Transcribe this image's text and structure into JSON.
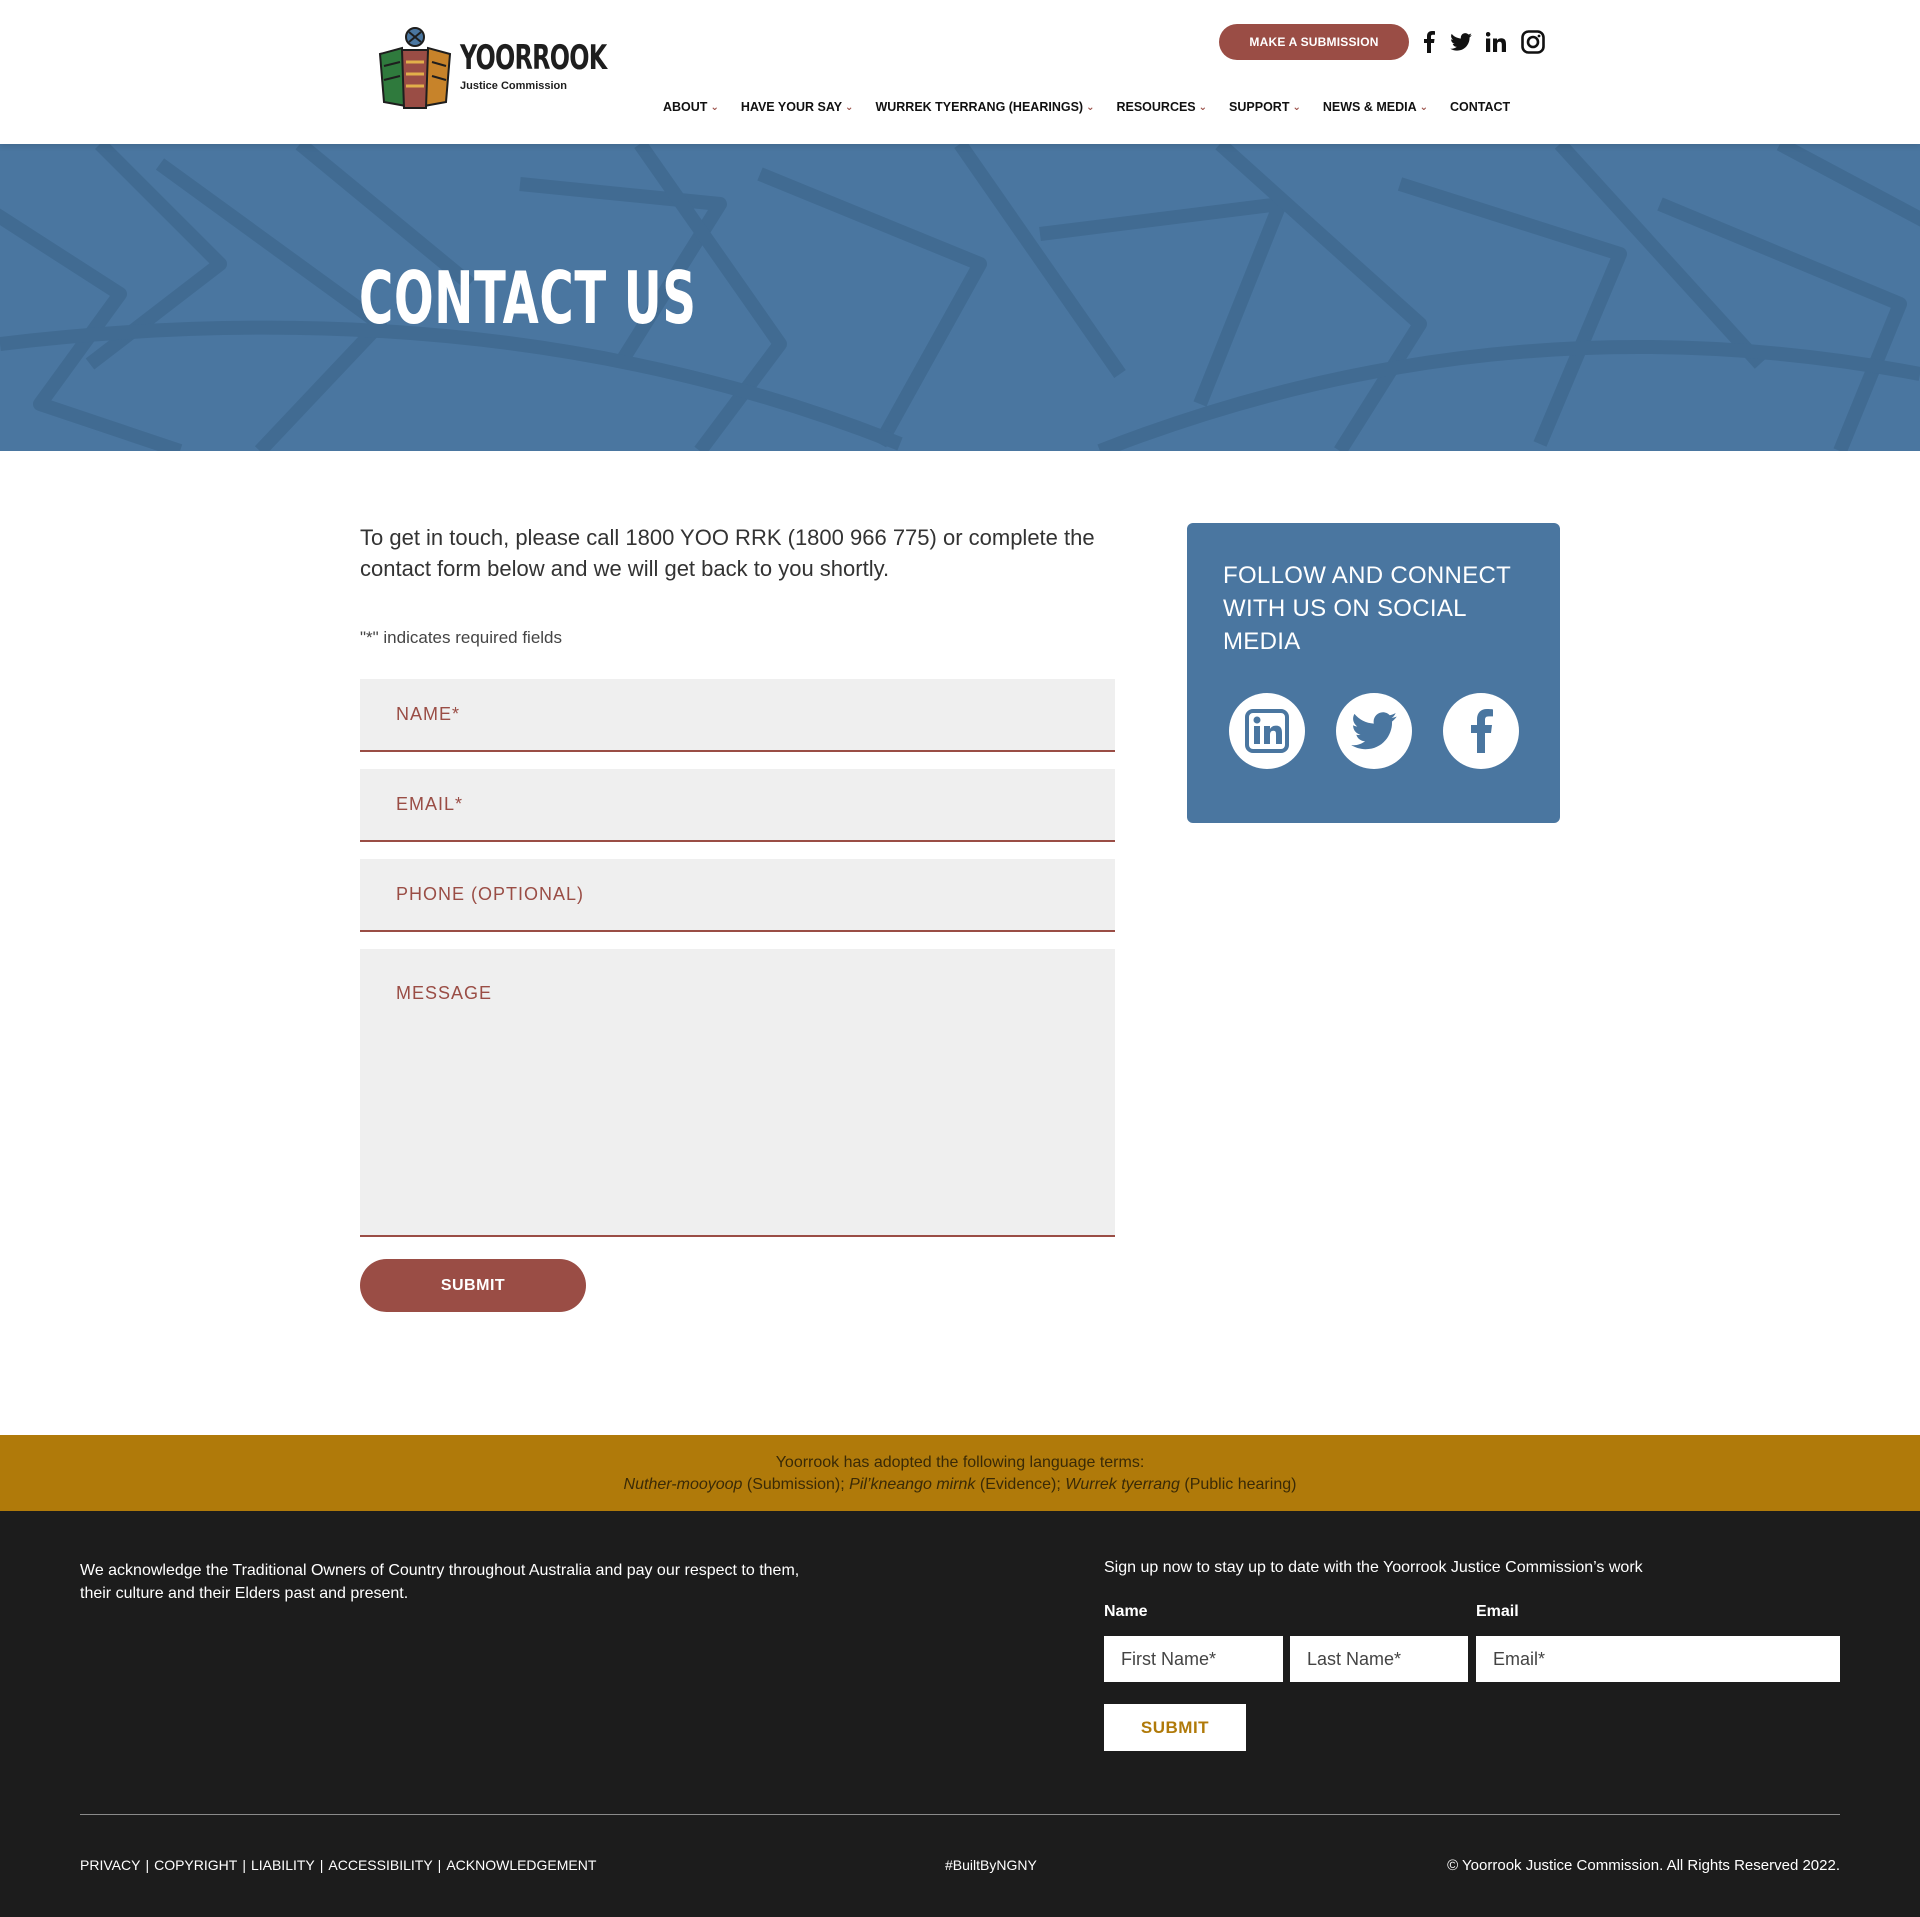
{
  "header": {
    "logo_name": "YOORROOK",
    "logo_subtitle": "Justice Commission",
    "submission_button": "MAKE A SUBMISSION",
    "social_icons": [
      "facebook-icon",
      "twitter-icon",
      "linkedin-icon",
      "instagram-icon"
    ],
    "nav": [
      {
        "label": "ABOUT",
        "dropdown": true
      },
      {
        "label": "HAVE YOUR SAY",
        "dropdown": true
      },
      {
        "label": "WURREK TYERRANG (HEARINGS)",
        "dropdown": true
      },
      {
        "label": "RESOURCES",
        "dropdown": true
      },
      {
        "label": "SUPPORT",
        "dropdown": true
      },
      {
        "label": "NEWS & MEDIA",
        "dropdown": true
      },
      {
        "label": "CONTACT",
        "dropdown": false
      }
    ]
  },
  "hero": {
    "title": "CONTACT US"
  },
  "main": {
    "intro": "To get in touch, please call 1800 YOO RRK (1800 966 775) or complete the contact form below and we will get back to you shortly.",
    "required_note": "\"*\" indicates required fields",
    "form": {
      "name_placeholder": "NAME*",
      "email_placeholder": "EMAIL*",
      "phone_placeholder": "PHONE (OPTIONAL)",
      "message_placeholder": "MESSAGE",
      "submit_label": "SUBMIT"
    }
  },
  "sidebar": {
    "title": "FOLLOW AND CONNECT WITH US ON SOCIAL MEDIA",
    "icons": [
      "linkedin-icon",
      "twitter-icon",
      "facebook-icon"
    ]
  },
  "language_bar": {
    "line1": "Yoorrook has adopted the following language terms:",
    "term1": "Nuther-mooyoop",
    "term1_meaning": " (Submission); ",
    "term2": "Pil’kneango mirnk",
    "term2_meaning": " (Evidence); ",
    "term3": "Wurrek tyerrang",
    "term3_meaning": " (Public hearing)"
  },
  "footer": {
    "acknowledgement": "We acknowledge the Traditional Owners of Country throughout Australia and pay our respect to them, their culture and their Elders past and present.",
    "signup_title": "Sign up now to stay up to date with the Yoorrook Justice Commission’s work",
    "name_label": "Name",
    "email_label": "Email",
    "first_name_placeholder": "First Name*",
    "last_name_placeholder": "Last Name*",
    "email_placeholder": "Email*",
    "submit_label": "SUBMIT",
    "links": [
      "PRIVACY",
      "COPYRIGHT",
      "LIABILITY",
      "ACCESSIBILITY",
      "ACKNOWLEDGEMENT"
    ],
    "link_separator": "|",
    "built_by": "#BuiltByNGNY",
    "copyright": "© Yoorrook Justice Commission. All Rights Reserved 2022."
  },
  "colors": {
    "brand_red": "#9a4d45",
    "hero_blue": "#4a76a0",
    "gold": "#b07a0a",
    "footer_dark": "#1c1c1c"
  }
}
